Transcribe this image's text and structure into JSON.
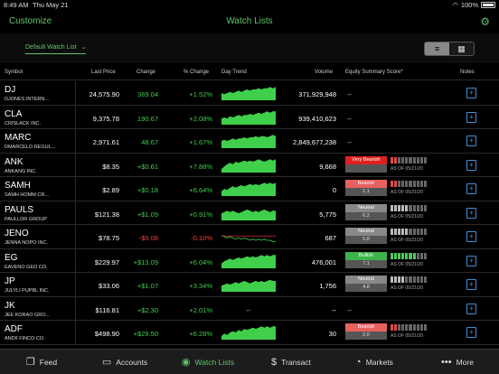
{
  "status": {
    "time": "8:49 AM",
    "date": "Thu May 21",
    "battery": "100%"
  },
  "nav": {
    "customize": "Customize",
    "title": "Watch Lists"
  },
  "watchlist": {
    "selected": "Default Watch List"
  },
  "headers": {
    "symbol": "Symbol",
    "last_price": "Last Price",
    "change": "Change",
    "pct_change": "% Change",
    "day_trend": "Day Trend",
    "volume": "Volume",
    "score": "Equity Summary Score*",
    "notes": "Notes"
  },
  "rows": [
    {
      "symbol": "DJ",
      "name": "DJONES INTERN...",
      "price": "24,575.90",
      "change": "369.04",
      "pct": "+1.52%",
      "volume": "371,929,948",
      "score": "--",
      "dir": "up",
      "trend": [
        6,
        5,
        6,
        7,
        6,
        7,
        8,
        7,
        8,
        9,
        8,
        9,
        9,
        10,
        9,
        10,
        10,
        11,
        10,
        11
      ]
    },
    {
      "symbol": "CLA",
      "name": "CRISLACK INC.",
      "price": "9,375.78",
      "change": "190.67",
      "pct": "+2.08%",
      "volume": "939,410,623",
      "score": "--",
      "dir": "up",
      "trend": [
        5,
        6,
        5,
        7,
        6,
        7,
        8,
        7,
        8,
        8,
        9,
        8,
        9,
        10,
        9,
        10,
        11,
        10,
        11,
        11
      ]
    },
    {
      "symbol": "MARC",
      "name": "DMARCELO REGUL...",
      "price": "2,971.61",
      "change": "48.67",
      "pct": "+1.67%",
      "volume": "2,849,677,238",
      "score": "--",
      "dir": "up",
      "trend": [
        6,
        7,
        6,
        7,
        8,
        7,
        8,
        8,
        9,
        8,
        9,
        9,
        10,
        9,
        10,
        10,
        9,
        10,
        11,
        10
      ]
    },
    {
      "symbol": "ANK",
      "name": "ANKANG INC.",
      "price": "$8.35",
      "change": "+$0.61",
      "pct": "+7.88%",
      "volume": "9,668",
      "dir": "up",
      "trend": [
        3,
        5,
        7,
        8,
        7,
        9,
        8,
        9,
        10,
        9,
        10,
        9,
        10,
        11,
        10,
        9,
        10,
        11,
        10,
        11
      ],
      "rating": {
        "label": "Very Bearish",
        "value": "",
        "color": "#e02020",
        "bars": 2,
        "barColor": "#e04848"
      }
    },
    {
      "symbol": "SAMH",
      "name": "SAMH HOMM CR...",
      "price": "$2.89",
      "change": "+$0.18",
      "pct": "+6.64%",
      "volume": "0",
      "dir": "up",
      "trend": [
        4,
        6,
        5,
        7,
        8,
        7,
        8,
        9,
        8,
        9,
        10,
        9,
        10,
        9,
        10,
        11,
        10,
        11,
        10,
        11
      ],
      "rating": {
        "label": "Bearish",
        "value": "1.1",
        "color": "#e86060",
        "bars": 2,
        "barColor": "#e04848"
      }
    },
    {
      "symbol": "PAULS",
      "name": "PAULLOR GROUP",
      "price": "$121.38",
      "change": "+$1.09",
      "pct": "+0.91%",
      "volume": "5,775",
      "dir": "up",
      "trend": [
        6,
        7,
        8,
        7,
        8,
        7,
        6,
        7,
        8,
        9,
        8,
        7,
        8,
        7,
        8,
        9,
        8,
        7,
        8,
        8
      ],
      "rating": {
        "label": "Neutral",
        "value": "6.2",
        "color": "#888888",
        "bars": 5,
        "barColor": "#bbbbbb"
      }
    },
    {
      "symbol": "JENO",
      "name": "JENNA NOPO INC.",
      "price": "$78.75",
      "change": "-$0.08",
      "pct": "-0.10%",
      "volume": "687",
      "dir": "down",
      "trend": [
        7,
        6,
        5,
        6,
        5,
        4,
        5,
        4,
        5,
        4,
        3,
        4,
        3,
        4,
        3,
        4,
        3,
        3,
        2,
        2
      ],
      "rating": {
        "label": "Neutral",
        "value": "5.8",
        "color": "#888888",
        "bars": 5,
        "barColor": "#bbbbbb"
      }
    },
    {
      "symbol": "EG",
      "name": "EAVENO GEO CO.",
      "price": "$229.97",
      "change": "+$13.09",
      "pct": "+6.04%",
      "volume": "476,001",
      "dir": "up",
      "trend": [
        4,
        6,
        7,
        8,
        7,
        8,
        9,
        8,
        9,
        10,
        9,
        10,
        9,
        10,
        11,
        10,
        11,
        10,
        11,
        11
      ],
      "rating": {
        "label": "Bullish",
        "value": "7.1",
        "color": "#3cb44b",
        "bars": 7,
        "barColor": "#4ec85a"
      }
    },
    {
      "symbol": "JP",
      "name": "JULYLI PUPBL INC.",
      "price": "$33.06",
      "change": "+$1.07",
      "pct": "+3.34%",
      "volume": "1,756",
      "dir": "up",
      "trend": [
        5,
        6,
        7,
        6,
        7,
        8,
        7,
        8,
        9,
        8,
        7,
        8,
        9,
        8,
        9,
        8,
        9,
        10,
        9,
        9
      ],
      "rating": {
        "label": "Neutral",
        "value": "4.8",
        "color": "#888888",
        "bars": 4,
        "barColor": "#bbbbbb"
      }
    },
    {
      "symbol": "JK",
      "name": "JEE KORAO GRO...",
      "price": "$116.81",
      "change": "+$2.30",
      "pct": "+2.01%",
      "volume": "--",
      "score": "--",
      "dir": "up",
      "trend": []
    },
    {
      "symbol": "ADF",
      "name": "ANDII FINCO CO.",
      "price": "$498.90",
      "change": "+$29.50",
      "pct": "+6.28%",
      "volume": "30",
      "dir": "up",
      "trend": [
        3,
        5,
        4,
        6,
        7,
        6,
        8,
        7,
        9,
        8,
        9,
        10,
        9,
        10,
        11,
        10,
        11,
        10,
        11,
        11
      ],
      "rating": {
        "label": "Bearish",
        "value": "2.0",
        "color": "#e86060",
        "bars": 2,
        "barColor": "#e04848"
      }
    }
  ],
  "asof": "AS OF 05/21/20",
  "tabs": [
    {
      "label": "Feed",
      "icon": "feed-icon"
    },
    {
      "label": "Accounts",
      "icon": "accounts-icon"
    },
    {
      "label": "Watch Lists",
      "icon": "eye-icon"
    },
    {
      "label": "Transact",
      "icon": "transact-icon"
    },
    {
      "label": "Markets",
      "icon": "markets-icon"
    },
    {
      "label": "More",
      "icon": "more-icon"
    }
  ]
}
